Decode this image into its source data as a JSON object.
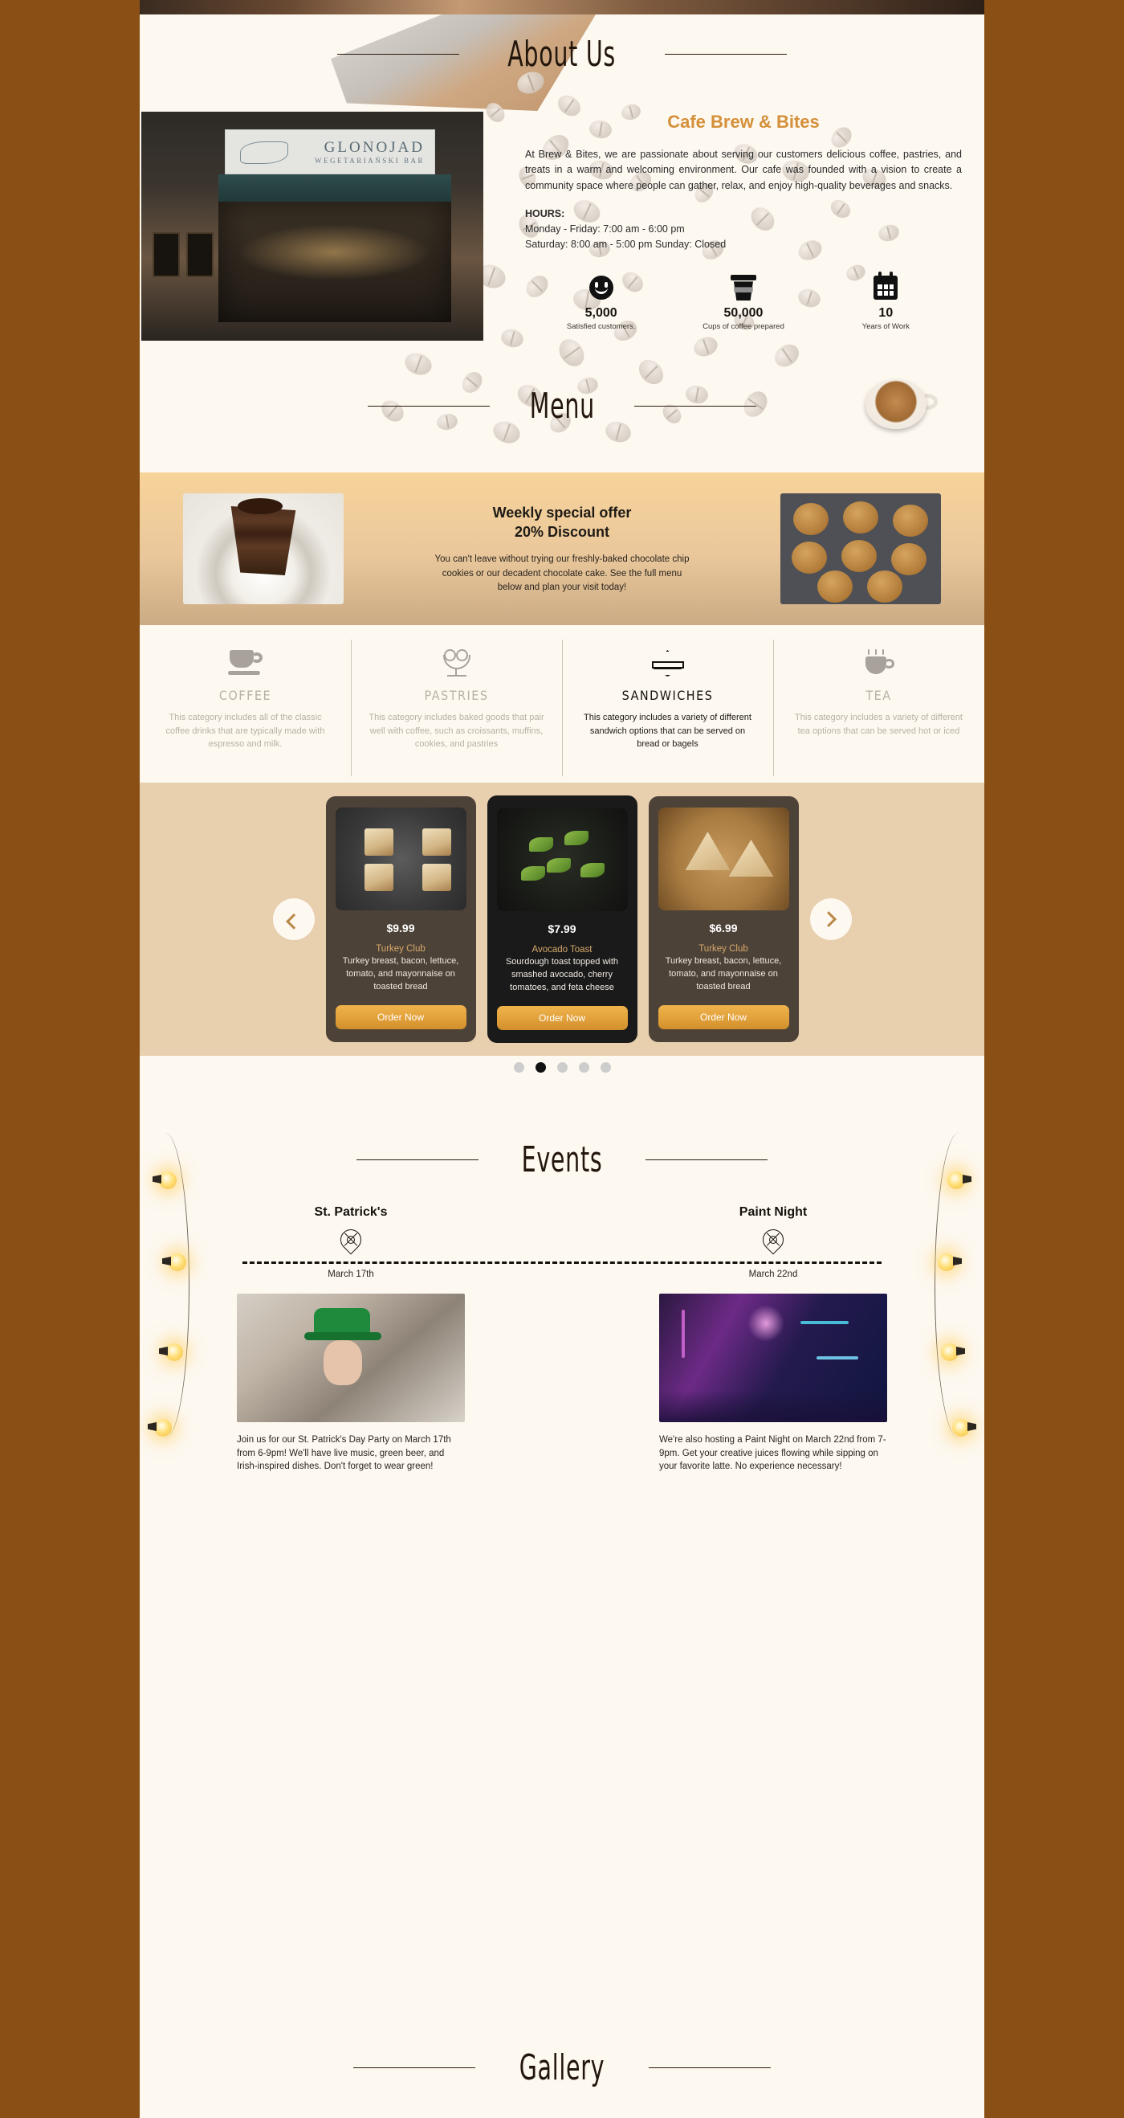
{
  "sections": {
    "about": {
      "heading": "About Us"
    },
    "menu": {
      "heading": "Menu"
    },
    "events": {
      "heading": "Events"
    },
    "gallery": {
      "heading": "Gallery"
    }
  },
  "storefront": {
    "sign_name": "GLONOJAD",
    "sign_sub": "WEGETARIAŃSKI BAR"
  },
  "about": {
    "title": "Cafe Brew & Bites",
    "paragraph": "At Brew & Bites, we are passionate about serving our customers delicious coffee, pastries, and treats in a warm and welcoming environment. Our cafe was founded with a vision to create a community space where people can gather, relax, and enjoy high-quality beverages and snacks.",
    "hours_label": "HOURS:",
    "hours_line1": "Monday - Friday: 7:00 am - 6:00 pm",
    "hours_line2": "Saturday: 8:00 am - 5:00 pm Sunday: Closed",
    "stats": [
      {
        "icon": "smiley-icon",
        "value": "5,000",
        "label": "Satisfied customers."
      },
      {
        "icon": "coffee-cup-icon",
        "value": "50,000",
        "label": "Cups of coffee prepared"
      },
      {
        "icon": "calendar-icon",
        "value": "10",
        "label": "Years of Work"
      }
    ]
  },
  "offer": {
    "title_line1": "Weekly special offer",
    "title_line2": "20% Discount",
    "text": "You can't leave without trying our freshly-baked chocolate chip cookies or our decadent chocolate cake. See the full menu below and plan your visit today!",
    "left_image_alt": "chocolate-cake",
    "right_image_alt": "chocolate-chip-cookies"
  },
  "categories": [
    {
      "icon": "coffee-cup-icon",
      "name": "COFFEE",
      "desc": "This category includes all of the classic coffee drinks that are typically made with espresso and milk.",
      "active": false
    },
    {
      "icon": "pastry-icon",
      "name": "PASTRIES",
      "desc": "This category includes baked goods that pair well with coffee, such as croissants, muffins, cookies, and pastries",
      "active": false
    },
    {
      "icon": "sandwich-icon",
      "name": "SANDWICHES",
      "desc": "This category includes a variety of different sandwich options that can be served on bread or bagels",
      "active": true
    },
    {
      "icon": "tea-cup-icon",
      "name": "TEA",
      "desc": "This category includes a variety of different tea options that can be served hot or iced",
      "active": false
    }
  ],
  "carousel": {
    "prev_label": "chevron-left",
    "next_label": "chevron-right",
    "order_label": "Order Now",
    "items": [
      {
        "price": "$9.99",
        "name": "Turkey Club",
        "desc": "Turkey breast, bacon, lettuce, tomato, and mayonnaise on toasted bread",
        "featured": false
      },
      {
        "price": "$7.99",
        "name": "Avocado Toast",
        "desc": "Sourdough toast topped with smashed avocado, cherry tomatoes, and feta cheese",
        "featured": true
      },
      {
        "price": "$6.99",
        "name": "Turkey Club",
        "desc": "Turkey breast, bacon, lettuce, tomato, and mayonnaise on toasted bread",
        "featured": false
      }
    ],
    "dots": 5,
    "active_dot": 1
  },
  "events": [
    {
      "title": "St. Patrick's",
      "date": "March 17th",
      "desc": "Join us for our St. Patrick's Day Party on March 17th from 6-9pm! We'll have live music, green beer, and Irish-inspired dishes. Don't forget to wear green!"
    },
    {
      "title": "Paint Night",
      "date": "March 22nd",
      "desc": "We're also hosting a Paint Night on March 22nd from 7-9pm. Get your creative juices flowing while sipping on your favorite latte. No experience necessary!"
    }
  ],
  "colors": {
    "frame": "#8a4f15",
    "page_bg": "#fdf8f0",
    "accent": "#d4903a",
    "offer_band": "#e9c79b",
    "carousel_band": "#e8cfae",
    "card_side": "#4d4238",
    "card_featured": "#1a1a1a",
    "button": "#e3a33d"
  }
}
